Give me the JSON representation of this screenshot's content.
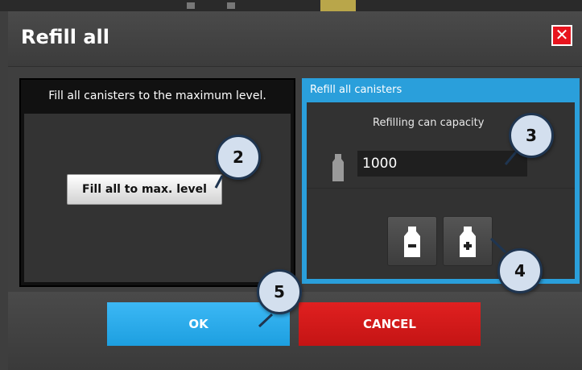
{
  "dialog": {
    "title": "Refill all",
    "close_glyph": "✕"
  },
  "left_panel": {
    "header": "Fill all canisters to the maximum level.",
    "fill_button_label": "Fill all to max. level"
  },
  "right_panel": {
    "header": "Refill all canisters",
    "capacity_label": "Refilling can capacity",
    "capacity_value": "1000",
    "decrease_icon": "bottle-minus-icon",
    "increase_icon": "bottle-plus-icon"
  },
  "footer": {
    "ok_label": "OK",
    "cancel_label": "CANCEL"
  },
  "markers": [
    "2",
    "3",
    "4",
    "5"
  ],
  "colors": {
    "accent_blue": "#2a9fdb",
    "ok_blue": "#1d9fe0",
    "cancel_red": "#c41414",
    "close_red": "#e8141e",
    "marker_fill": "#d3dfee",
    "marker_border": "#1f3550"
  }
}
